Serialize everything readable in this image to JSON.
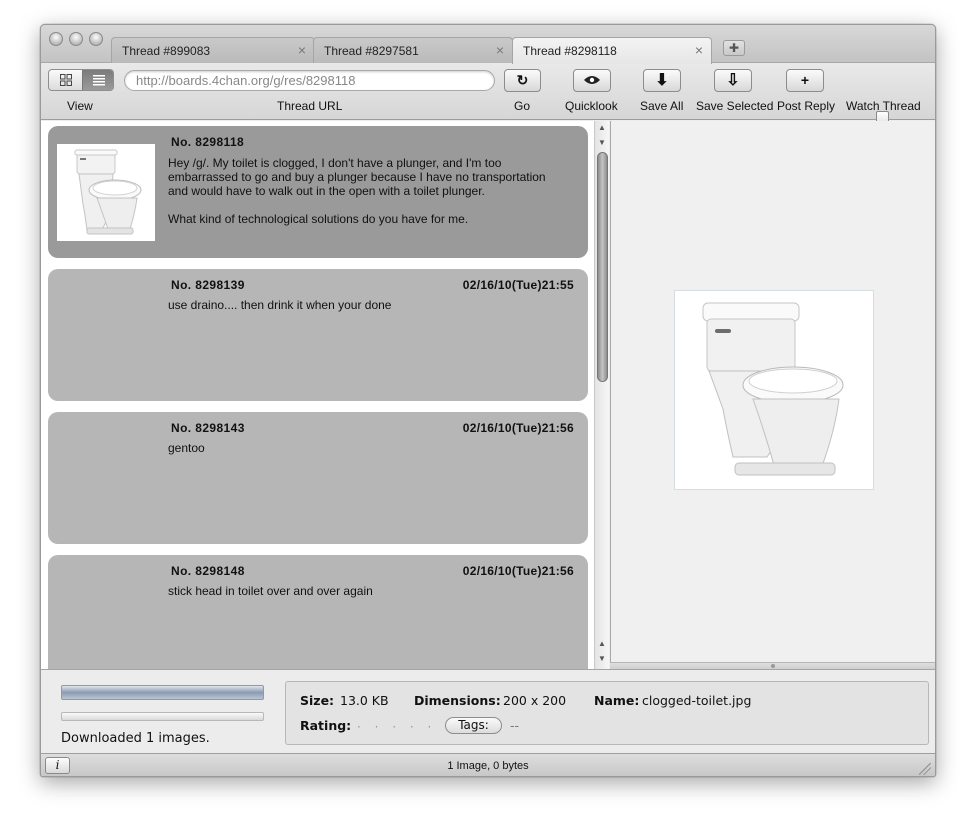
{
  "tabs": [
    {
      "label": "Thread #899083",
      "active": false
    },
    {
      "label": "Thread #8297581",
      "active": false
    },
    {
      "label": "Thread #8298118",
      "active": true
    }
  ],
  "toolbar": {
    "url": "http://boards.4chan.org/g/res/8298118",
    "view_label": "View",
    "url_label": "Thread URL",
    "go_label": "Go",
    "quicklook_label": "Quicklook",
    "save_all_label": "Save All",
    "save_selected_label": "Save Selected",
    "post_reply_label": "Post Reply",
    "watch_thread_label": "Watch Thread",
    "go_glyph": "↻",
    "quicklook_glyph": "👁",
    "save_all_glyph": "⬇",
    "save_selected_glyph": "⇩",
    "post_reply_glyph": "+"
  },
  "posts": [
    {
      "number_label": "No.  8298118",
      "date": "",
      "lines": [
        "Hey /g/. My toilet is clogged, I don't have a plunger, and I'm too",
        "embarrassed to go and buy a plunger because I have no transportation",
        "and would have to walk out in the open with a toilet plunger.",
        "",
        "What kind of technological solutions do you have for me."
      ]
    },
    {
      "number_label": "No.  8298139",
      "date": "02/16/10(Tue)21:55",
      "lines": [
        "use draino.... then drink it when your done"
      ]
    },
    {
      "number_label": "No.  8298143",
      "date": "02/16/10(Tue)21:56",
      "lines": [
        "gentoo"
      ]
    },
    {
      "number_label": "No.  8298148",
      "date": "02/16/10(Tue)21:56",
      "lines": [
        "stick head in toilet over and over again"
      ]
    }
  ],
  "download": {
    "status": "Downloaded 1 images."
  },
  "info": {
    "size_label": "Size:",
    "size_value": "13.0 KB",
    "dimensions_label": "Dimensions:",
    "dimensions_value": "200 x 200",
    "name_label": "Name:",
    "name_value": "clogged-toilet.jpg",
    "rating_label": "Rating:",
    "rating_value": "· · · · ·",
    "tags_label": "Tags:",
    "tags_value": "--"
  },
  "statusbar": {
    "info_glyph": "i",
    "text": "1 Image, 0 bytes"
  },
  "colors": {
    "op_post": "#9a9a9a",
    "reply_post": "#b6b6b6",
    "progress": "#8c9bb0"
  },
  "icons": [
    "thumbnail-grid-icon",
    "list-icon",
    "reload-icon",
    "eye-icon",
    "download-arrow-icon",
    "download-outline-arrow-icon",
    "plus-icon",
    "info-icon",
    "resize-grip-icon"
  ]
}
